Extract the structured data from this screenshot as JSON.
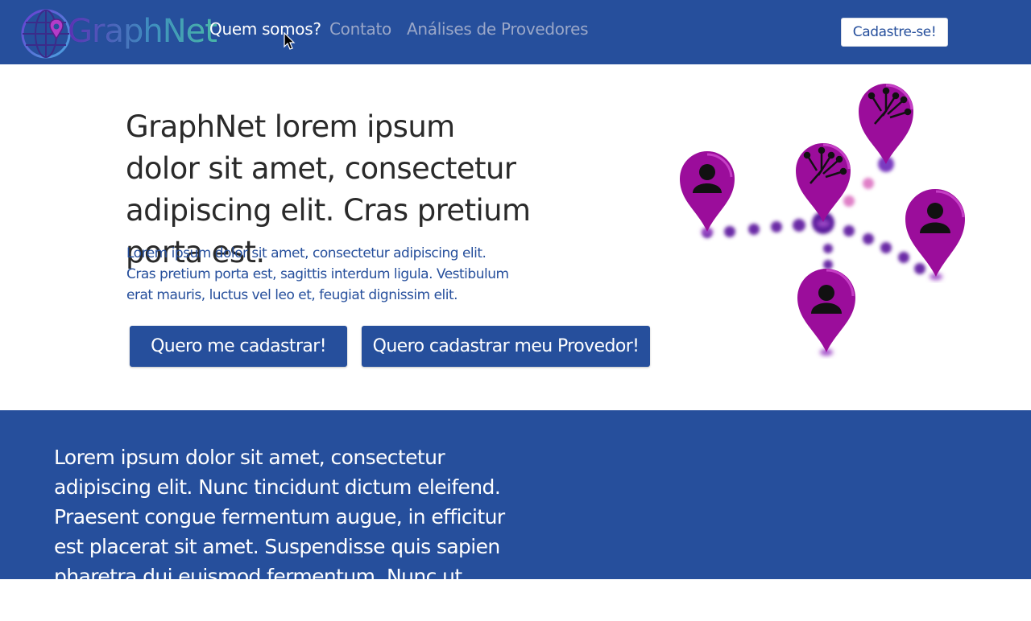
{
  "brand": {
    "logo_text": "GraphNet"
  },
  "nav": {
    "links": [
      {
        "label": "Quem somos?"
      },
      {
        "label": "Contato"
      },
      {
        "label": "Análises de Provedores"
      }
    ],
    "signup_label": "Cadastre-se!"
  },
  "hero": {
    "title": "GraphNet lorem ipsum dolor sit amet, consectetur adipiscing elit. Cras pretium porta est.",
    "subtitle": "Lorem ipsum dolor sit amet, consectetur adipiscing elit. Cras pretium porta est, sagittis interdum ligula. Vestibulum erat mauris, luctus vel leo et, feugiat dignissim elit.",
    "cta_user": "Quero me cadastrar!",
    "cta_provider": "Quero cadastrar meu Provedor!"
  },
  "section": {
    "text": "Lorem ipsum dolor sit amet, consectetur adipiscing elit. Nunc tincidunt dictum eleifend. Praesent congue fermentum augue, in efficitur est placerat sit amet. Suspendisse quis sapien pharetra dui euismod fermentum. Nunc ut lorem"
  },
  "colors": {
    "brand_blue": "#264f9c",
    "pin_magenta": "#9b0d9b",
    "white": "#ffffff"
  },
  "icons": {
    "pins": [
      "user-icon",
      "circuit-icon",
      "circuit-icon",
      "user-icon",
      "user-icon"
    ]
  }
}
